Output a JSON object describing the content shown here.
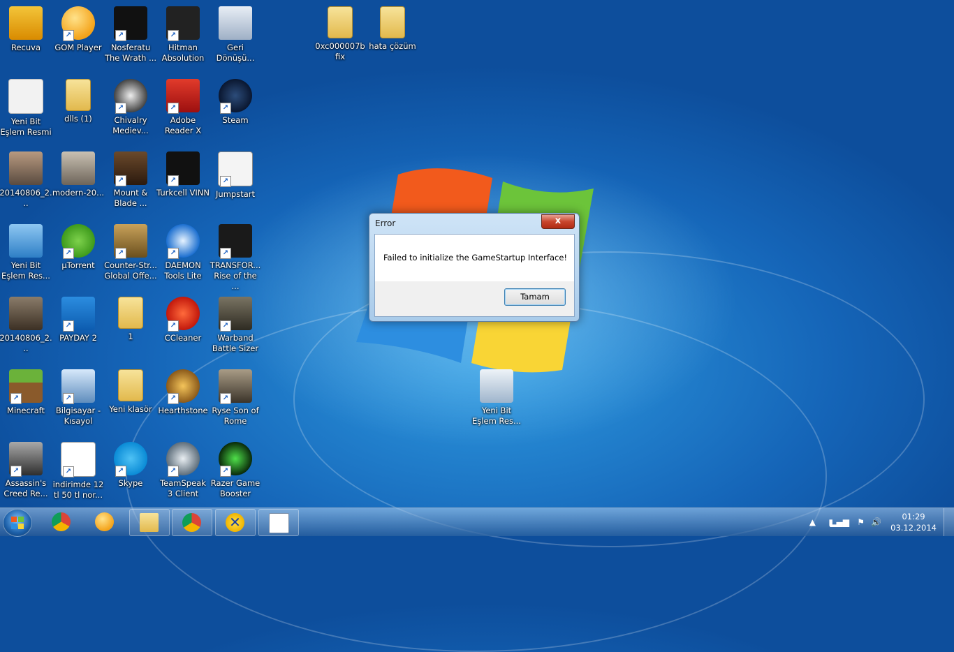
{
  "desktop_icons": [
    {
      "label": "Recuva",
      "shortcut": false
    },
    {
      "label": "GOM Player",
      "shortcut": true
    },
    {
      "label": "Nosferatu The Wrath ...",
      "shortcut": true
    },
    {
      "label": "Hitman Absolution",
      "shortcut": true
    },
    {
      "label": "Geri Dönüşü...",
      "shortcut": false
    },
    {
      "label": "0xc000007b fix",
      "shortcut": false
    },
    {
      "label": "hata çözüm",
      "shortcut": false
    },
    {
      "label": "Yeni Bit Eşlem Resmi",
      "shortcut": false
    },
    {
      "label": "dlls (1)",
      "shortcut": false
    },
    {
      "label": "Chivalry Mediev...",
      "shortcut": true
    },
    {
      "label": "Adobe Reader X",
      "shortcut": true
    },
    {
      "label": "Steam",
      "shortcut": true
    },
    {
      "label": "20140806_2...",
      "shortcut": false
    },
    {
      "label": "modern-20...",
      "shortcut": false
    },
    {
      "label": "Mount & Blade ...",
      "shortcut": true
    },
    {
      "label": "Turkcell VINN",
      "shortcut": true
    },
    {
      "label": "Jumpstart",
      "shortcut": true
    },
    {
      "label": "Yeni Bit Eşlem Res...",
      "shortcut": false
    },
    {
      "label": "µTorrent",
      "shortcut": true
    },
    {
      "label": "Counter-Str... Global Offe...",
      "shortcut": true
    },
    {
      "label": "DAEMON Tools Lite",
      "shortcut": true
    },
    {
      "label": "TRANSFOR... Rise of the ...",
      "shortcut": true
    },
    {
      "label": "20140806_2...",
      "shortcut": false
    },
    {
      "label": "PAYDAY 2",
      "shortcut": true
    },
    {
      "label": "1",
      "shortcut": false
    },
    {
      "label": "CCleaner",
      "shortcut": true
    },
    {
      "label": "Warband Battle Sizer",
      "shortcut": true
    },
    {
      "label": "Minecraft",
      "shortcut": true
    },
    {
      "label": "Bilgisayar - Kısayol",
      "shortcut": true
    },
    {
      "label": "Yeni klasör",
      "shortcut": false
    },
    {
      "label": "Hearthstone",
      "shortcut": true
    },
    {
      "label": "Ryse Son of Rome",
      "shortcut": true
    },
    {
      "label": "Assassin's Creed Re...",
      "shortcut": true
    },
    {
      "label": "indirimde 12 tl 50 tl nor...",
      "shortcut": true
    },
    {
      "label": "Skype",
      "shortcut": true
    },
    {
      "label": "TeamSpeak 3 Client",
      "shortcut": true
    },
    {
      "label": "Razer Game Booster",
      "shortcut": true
    },
    {
      "label": "Yeni Bit Eşlem Res...",
      "shortcut": false
    }
  ],
  "dialog": {
    "title": "Error",
    "close_label": "x",
    "message": "Failed to initialize the GameStartup Interface!",
    "ok_label": "Tamam"
  },
  "taskbar": {
    "items": [
      {
        "name": "chrome-icon"
      },
      {
        "name": "gom-player-icon"
      },
      {
        "name": "explorer-icon"
      },
      {
        "name": "chrome-icon"
      },
      {
        "name": "app-x-icon"
      },
      {
        "name": "window-icon"
      }
    ],
    "time": "01:29",
    "date": "03.12.2014"
  },
  "colors": {
    "accent": "#1565b8",
    "dialog_border": "#5a7ea6",
    "close_red": "#c8452d"
  }
}
